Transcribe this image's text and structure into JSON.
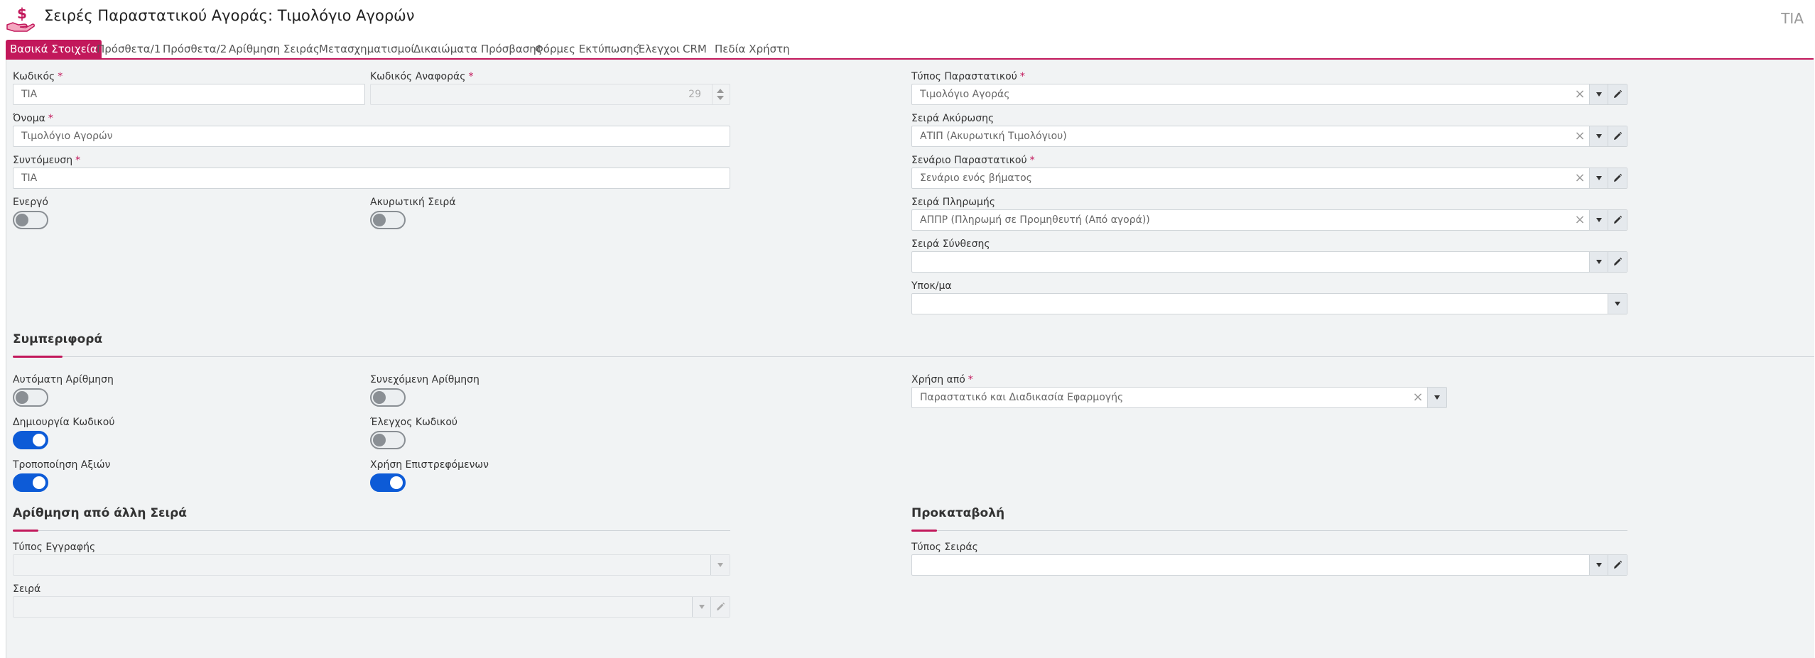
{
  "header": {
    "title": "Σειρές Παραστατικού Αγοράς: Τιμολόγιο Αγορών",
    "code": "ΤΙΑ"
  },
  "colors": {
    "accent": "#c2185b",
    "toggle_on": "#0d5bd7"
  },
  "tabs": [
    {
      "label": "Βασικά Στοιχεία",
      "active": true
    },
    {
      "label": "Πρόσθετα/1"
    },
    {
      "label": "Πρόσθετα/2"
    },
    {
      "label": "Αρίθμηση Σειράς"
    },
    {
      "label": "Μετασχηματισμοί"
    },
    {
      "label": "Δικαιώματα Πρόσβασης"
    },
    {
      "label": "Φόρμες Εκτύπωσης"
    },
    {
      "label": "Έλεγχοι"
    },
    {
      "label": "CRM"
    },
    {
      "label": "Πεδία Χρήστη"
    }
  ],
  "form": {
    "code": {
      "label": "Κωδικός",
      "value": "ΤΙΑ"
    },
    "ref_code": {
      "label": "Κωδικός Αναφοράς",
      "value": "29"
    },
    "name": {
      "label": "Όνομα",
      "value": "Τιμολόγιο Αγορών"
    },
    "abbr": {
      "label": "Συντόμευση",
      "value": "ΤΙΑ"
    },
    "active": {
      "label": "Ενεργό",
      "on": false
    },
    "cancel_series": {
      "label": "Ακυρωτική Σειρά",
      "on": false
    },
    "doc_type": {
      "label": "Τύπος Παραστατικού",
      "value": "Τιμολόγιο Αγοράς"
    },
    "cancel_series_ref": {
      "label": "Σειρά Ακύρωσης",
      "value": "ΑΤΙΠ (Ακυρωτική Τιμολόγιου)"
    },
    "doc_scenario": {
      "label": "Σενάριο Παραστατικού",
      "value": "Σενάριο ενός βήματος"
    },
    "payment_series": {
      "label": "Σειρά Πληρωμής",
      "value": "ΑΠΠΡ (Πληρωμή σε Προμηθευτή (Από αγορά))"
    },
    "composition_series": {
      "label": "Σειρά Σύνθεσης",
      "value": ""
    },
    "branch": {
      "label": "Υποκ/μα",
      "value": ""
    }
  },
  "behavior": {
    "title": "Συμπεριφορά",
    "auto_numbering": {
      "label": "Αυτόματη Αρίθμηση",
      "on": false
    },
    "continuous_numbering": {
      "label": "Συνεχόμενη Αρίθμηση",
      "on": false
    },
    "create_code": {
      "label": "Δημιουργία Κωδικού",
      "on": true
    },
    "check_code": {
      "label": "Έλεγχος Κωδικού",
      "on": false
    },
    "modify_values": {
      "label": "Τροποποίηση Αξιών",
      "on": true
    },
    "use_returns": {
      "label": "Χρήση Επιστρεφόμενων",
      "on": true
    },
    "used_by": {
      "label": "Χρήση από",
      "value": "Παραστατικό και Διαδικασία Εφαρμογής"
    }
  },
  "other_numbering": {
    "title": "Αρίθμηση από άλλη Σειρά",
    "record_type": {
      "label": "Τύπος Εγγραφής",
      "value": ""
    },
    "series": {
      "label": "Σειρά",
      "value": ""
    }
  },
  "prepayment": {
    "title": "Προκαταβολή",
    "series_type": {
      "label": "Τύπος Σειράς",
      "value": ""
    }
  }
}
